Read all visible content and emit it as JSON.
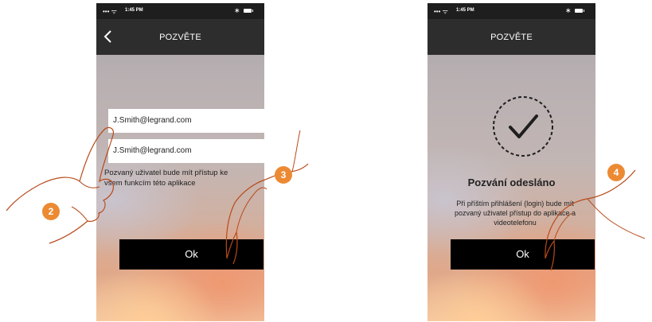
{
  "left_screen": {
    "status": {
      "time": "1:45 PM",
      "signal": "••• ᯤ",
      "bluetooth": "∗"
    },
    "nav": {
      "title": "POZVĚTE"
    },
    "email_field": {
      "value": "J.Smith@legrand.com"
    },
    "confirm_field": {
      "value": "J.Smith@legrand.com"
    },
    "info_text": "Pozvaný uživatel bude mít přístup ke všem funkcím této aplikace",
    "ok_label": "Ok",
    "step_badge": "3"
  },
  "right_screen": {
    "status": {
      "time": "1:45 PM",
      "signal": "••• ᯤ",
      "bluetooth": "∗"
    },
    "nav": {
      "title": "POZVĚTE"
    },
    "sent_title": "Pozvání odesláno",
    "sent_body": "Při příštím přihlášení (login) bude mít pozvaný uživatel přístup do aplikace a videotelefonu",
    "ok_label": "Ok",
    "step_badge": "4"
  },
  "hand_badge_left": "2",
  "colors": {
    "badge": "#ec8a33",
    "status_bar": "#1e1e1e",
    "nav_bar": "#2d2d2d",
    "button": "#000000"
  },
  "icons": [
    "back-arrow-icon",
    "bluetooth-icon",
    "battery-icon",
    "wifi-icon",
    "checkmark-icon"
  ]
}
